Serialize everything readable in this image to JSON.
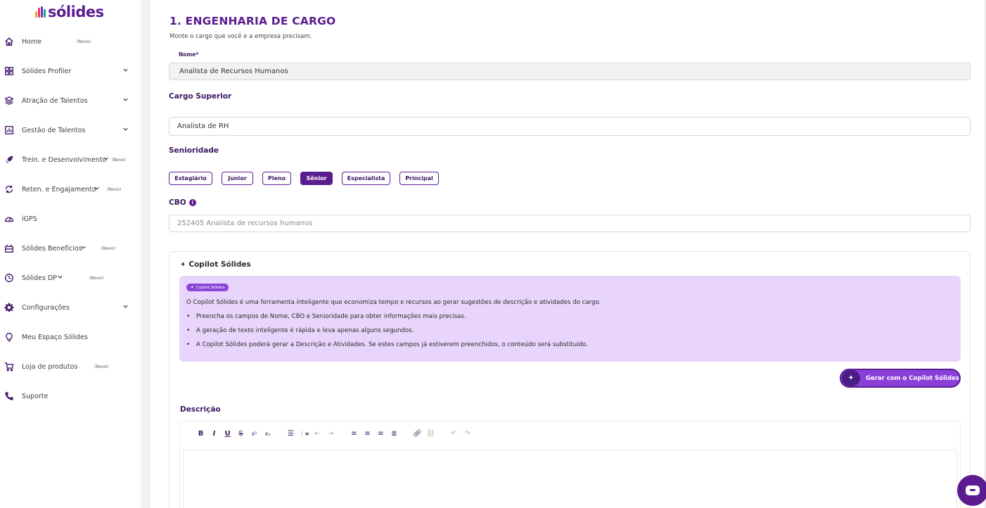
{
  "brand": {
    "name": "sólides"
  },
  "sidebar": {
    "items": [
      {
        "label": "Home",
        "badge": "(Novo)",
        "icon": "home-icon",
        "chevron": false
      },
      {
        "label": "Sólides Profiler",
        "badge": "",
        "icon": "grid-icon",
        "chevron": true
      },
      {
        "label": "Atração de Talentos",
        "badge": "",
        "icon": "layers-icon",
        "chevron": true
      },
      {
        "label": "Gestão de Talentos",
        "badge": "",
        "icon": "chart-icon",
        "chevron": true
      },
      {
        "label": "Trein. e Desenvolvimento",
        "badge": "(Novo)",
        "icon": "rocket-icon",
        "chevron": true
      },
      {
        "label": "Reten. e Engajamento",
        "badge": "(Novo)",
        "icon": "refresh-icon",
        "chevron": true
      },
      {
        "label": "iGPS",
        "badge": "",
        "icon": "gauge-icon",
        "chevron": false
      },
      {
        "label": "Sólides Benefícios",
        "badge": "(Novo)",
        "icon": "gift-icon",
        "chevron": true
      },
      {
        "label": "Sólides DP",
        "badge": "(Novo)",
        "icon": "clock-icon",
        "chevron": true
      },
      {
        "label": "Configurações",
        "badge": "",
        "icon": "gear-icon",
        "chevron": true
      },
      {
        "label": "Meu Espaço Sólides",
        "badge": "",
        "icon": "lightbulb-icon",
        "chevron": false
      },
      {
        "label": "Loja de produtos",
        "badge": "(Novo)",
        "icon": "cart-icon",
        "chevron": false
      },
      {
        "label": "Suporte",
        "badge": "",
        "icon": "phone-icon",
        "chevron": false
      }
    ]
  },
  "page": {
    "title": "1. ENGENHARIA DE CARGO",
    "subtitle": "Monte o cargo que você e a empresa precisam."
  },
  "form": {
    "name_label": "Nome*",
    "name_value": "Analista de Recursos Humanos",
    "superior_label": "Cargo Superior",
    "superior_value": "Analista de RH",
    "seniority_label": "Senioridade",
    "seniority_options": [
      "Estagiário",
      "Junior",
      "Pleno",
      "Sênior",
      "Especialista",
      "Principal"
    ],
    "seniority_selected": "Sênior",
    "cbo_label": "CBO",
    "cbo_placeholder": "252405 Analista de recursos humanos"
  },
  "copilot": {
    "title": "Copilot Sólides",
    "badge": "Copilot Sólides",
    "intro": "O Copilot Sólides é uma ferramenta inteligente que economiza tempo e recursos ao gerar sugestões de descrição e atividades do cargo.",
    "bullets": [
      "Preencha os campos de Nome, CBO e Senioridade para obter informações mais precisas.",
      "A geração de texto inteligente é rápida e leva apenas alguns segundos.",
      "A Copilot Sólides poderá gerar a Descrição e Atividades. Se estes campos já estiverem preenchidos, o conteúdo será substituído."
    ],
    "button_label": "Gerar com o Copilot Sólides"
  },
  "description": {
    "label": "Descrição"
  },
  "colors": {
    "brand_purple": "#5b1c8f",
    "copilot_bg": "#e9d5fb",
    "button_purple": "#8b3fd9"
  }
}
